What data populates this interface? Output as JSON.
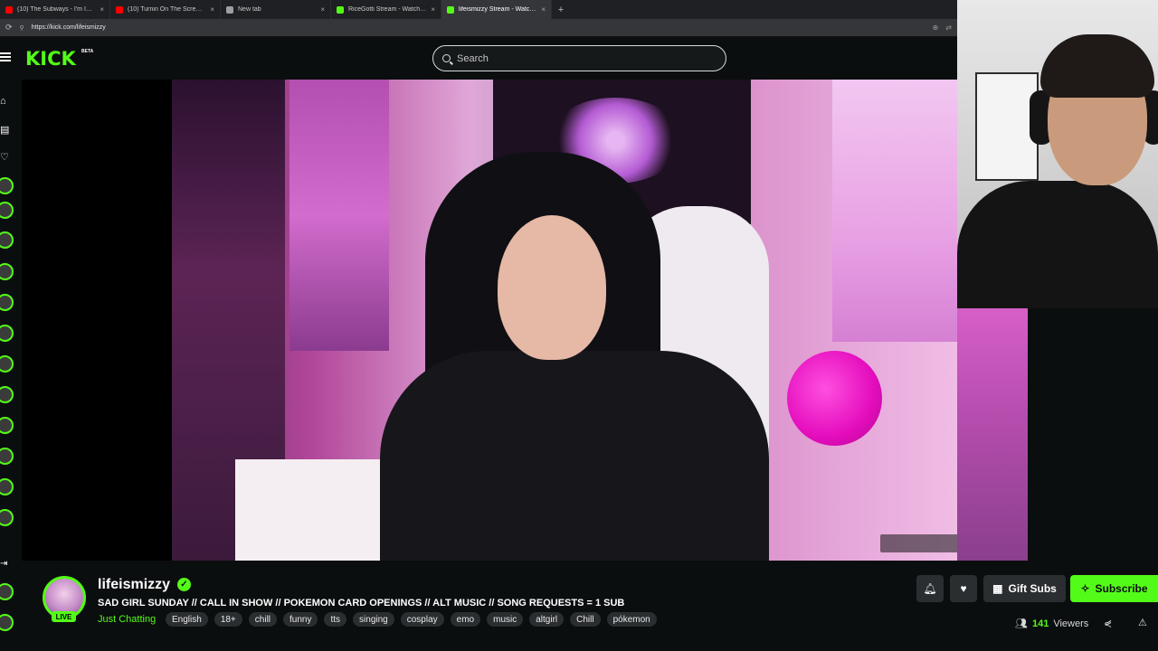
{
  "browser": {
    "tabs": [
      {
        "label": "(10) The Subways - I'm In Love And",
        "favicon_color": "#ff0000",
        "active": false
      },
      {
        "label": "(10) Turnin On The Screw - YouTube",
        "favicon_color": "#ff0000",
        "active": false
      },
      {
        "label": "New tab",
        "favicon_color": "#9aa0a6",
        "active": false
      },
      {
        "label": "RiceGotti Stream - Watch Live on Kick",
        "favicon_color": "#53fc18",
        "active": false
      },
      {
        "label": "lifeismizzy Stream - Watch Live on Kick",
        "favicon_color": "#53fc18",
        "active": true
      }
    ],
    "new_tab_symbol": "+",
    "close_symbol": "×",
    "url": "https://kick.com/lifeismizzy"
  },
  "header": {
    "logo_text": "KICK",
    "logo_badge": "BETA",
    "search_placeholder": "Search"
  },
  "stream": {
    "channel_name": "lifeismizzy",
    "live_label": "LIVE",
    "title": "SAD GIRL SUNDAY // CALL IN SHOW // POKEMON CARD OPENINGS // ALT MUSIC // SONG REQUESTS = 1 SUB",
    "category": "Just Chatting",
    "tags": [
      "English",
      "18+",
      "chill",
      "funny",
      "tts",
      "singing",
      "cosplay",
      "emo",
      "music",
      "altgirl",
      "Chill",
      "pókemon"
    ],
    "viewers_count": "141",
    "viewers_label": "Viewers"
  },
  "actions": {
    "gift_label": "Gift Subs",
    "subscribe_label": "Subscribe"
  },
  "colors": {
    "brand_green": "#53fc18",
    "background": "#0b0e0f",
    "button_dark": "#2a2e31"
  }
}
